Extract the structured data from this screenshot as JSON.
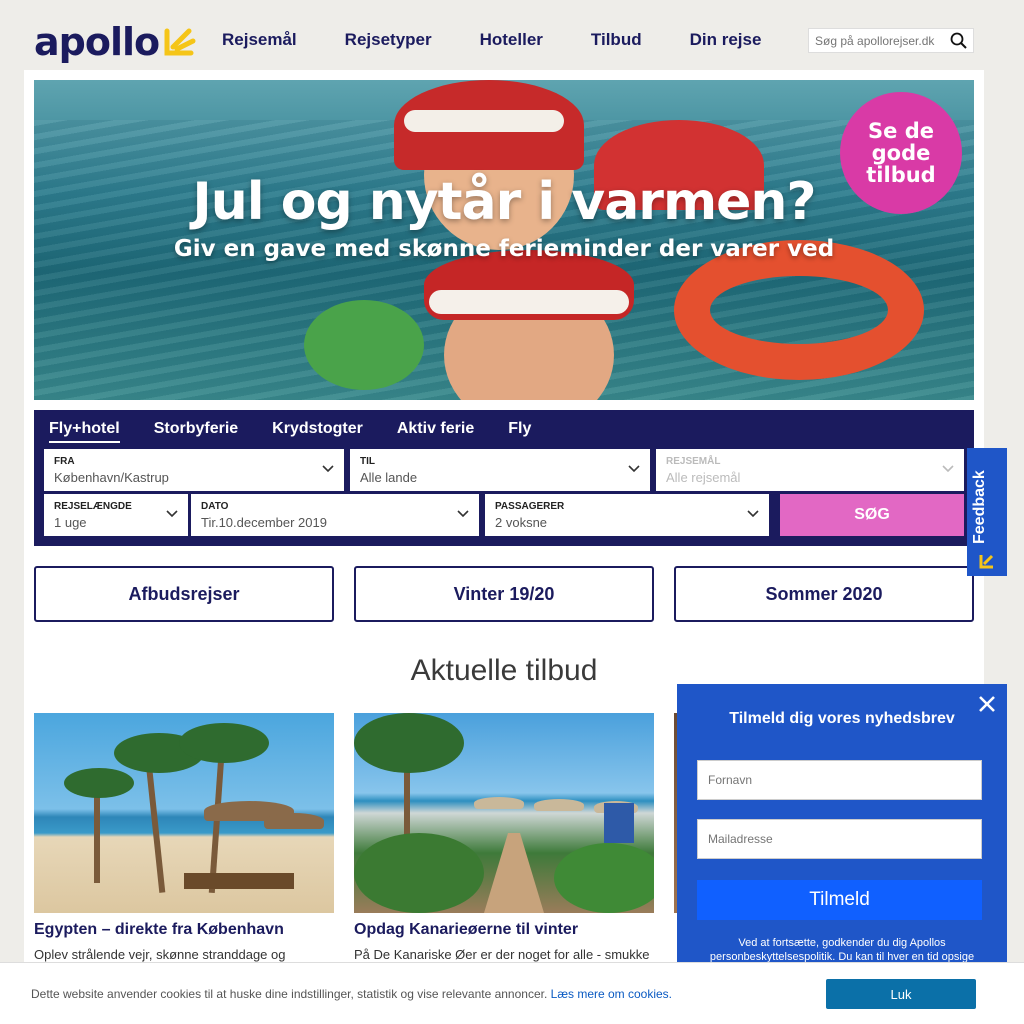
{
  "header": {
    "logo_text": "apollo",
    "nav": [
      "Rejsemål",
      "Rejsetyper",
      "Hoteller",
      "Tilbud",
      "Din rejse"
    ],
    "search_placeholder": "Søg på apollorejser.dk"
  },
  "hero": {
    "title": "Jul og nytår i varmen?",
    "subtitle": "Giv en gave med skønne ferieminder der varer ved",
    "badge_line1": "Se de",
    "badge_line2": "gode",
    "badge_line3": "tilbud"
  },
  "search_panel": {
    "tabs": [
      "Fly+hotel",
      "Storbyferie",
      "Krydstogter",
      "Aktiv ferie",
      "Fly"
    ],
    "active_tab": "Fly+hotel",
    "fields": {
      "fra": {
        "label": "FRA",
        "value": "København/Kastrup"
      },
      "til": {
        "label": "TIL",
        "value": "Alle lande"
      },
      "rejsemaal": {
        "label": "REJSEMÅL",
        "value": "Alle rejsemål"
      },
      "rejselaengde": {
        "label": "REJSELÆNGDE",
        "value": "1 uge"
      },
      "dato": {
        "label": "DATO",
        "value": "Tir.10.december 2019"
      },
      "passagerer": {
        "label": "PASSAGERER",
        "value": "2 voksne"
      }
    },
    "search_button": "SØG"
  },
  "categories": [
    "Afbudsrejser",
    "Vinter 19/20",
    "Sommer 2020"
  ],
  "offers": {
    "title": "Aktuelle tilbud",
    "cards": [
      {
        "title": "Egypten – direkte fra København",
        "desc": "Oplev strålende vejr, skønne stranddage og"
      },
      {
        "title": "Opdag Kanarieøerne til vinter",
        "desc": "På De Kanariske Øer er der noget for alle - smukke"
      }
    ]
  },
  "feedback": {
    "label": "Feedback"
  },
  "newsletter": {
    "title": "Tilmeld dig vores nyhedsbrev",
    "firstname_placeholder": "Fornavn",
    "email_placeholder": "Mailadresse",
    "submit": "Tilmeld",
    "legal_line1": "Ved at fortsætte, godkender du dig Apollos",
    "legal_line2": "personbeskyttelsespolitik. Du kan til hver en tid opsige"
  },
  "cookie": {
    "text": "Dette website anvender cookies til at huske dine indstillinger, statistik og vise relevante annoncer. ",
    "link": "Læs mere om cookies.",
    "button": "Luk"
  },
  "colors": {
    "brand_navy": "#1b1b5e",
    "brand_yellow": "#f5c518",
    "badge_pink": "#d93aa6",
    "search_pink": "#e268c4",
    "newsletter_blue": "#1f56c8",
    "cookie_button": "#0b70a8"
  },
  "icons": {
    "logo": "apollo-sun-icon",
    "search": "search-icon",
    "chevron": "chevron-down-icon",
    "close": "close-icon"
  }
}
